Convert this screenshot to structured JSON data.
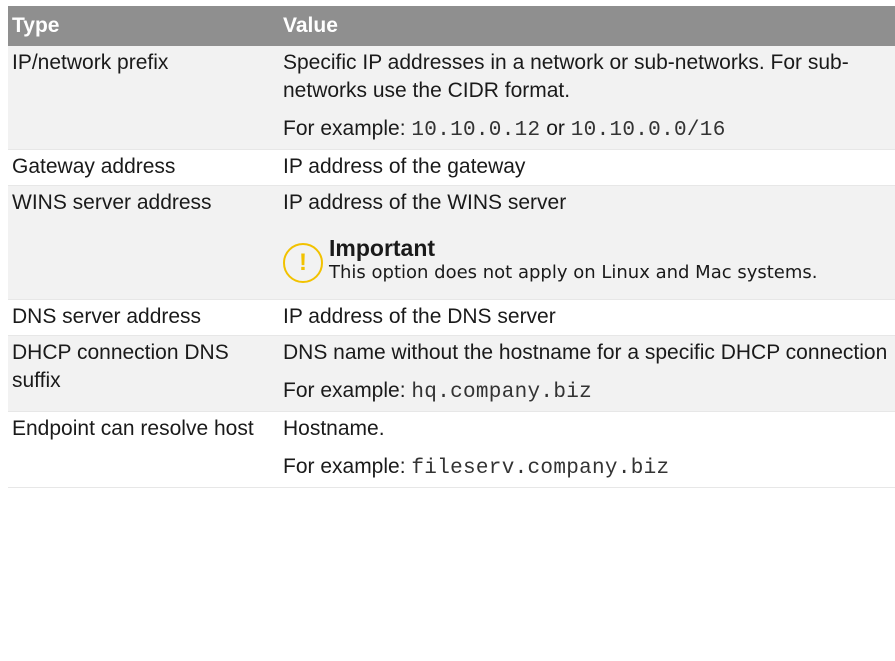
{
  "table": {
    "headers": {
      "type": "Type",
      "value": "Value"
    },
    "rows": [
      {
        "type": "IP/network prefix",
        "value_lines": [
          "Specific IP addresses in a network or sub-networks. For sub-networks use the CIDR format."
        ],
        "example": {
          "prefix": "For example: ",
          "code1": "10.10.0.12",
          "joiner": " or ",
          "code2": "10.10.0.0/16"
        }
      },
      {
        "type": "Gateway address",
        "value_lines": [
          "IP address of the gateway"
        ]
      },
      {
        "type": "WINS server address",
        "value_lines": [
          "IP address of the WINS server"
        ],
        "callout": {
          "icon": "!",
          "title": "Important",
          "text": "This option does not apply on Linux and Mac systems."
        }
      },
      {
        "type": "DNS server address",
        "value_lines": [
          "IP address of the DNS server"
        ]
      },
      {
        "type": "DHCP connection DNS suffix",
        "value_lines": [
          "DNS name without the hostname for a specific DHCP connection"
        ],
        "example": {
          "prefix": "For example: ",
          "code1": "hq.company.biz"
        }
      },
      {
        "type": "Endpoint can resolve host",
        "value_lines": [
          "Hostname."
        ],
        "example": {
          "prefix": "For example: ",
          "code1": "fileserv.company.biz"
        }
      }
    ]
  },
  "colors": {
    "header_bg": "#8f8f8f",
    "header_text": "#ffffff",
    "row_alt_bg": "#f2f2f2",
    "callout_accent": "#f2c200"
  }
}
